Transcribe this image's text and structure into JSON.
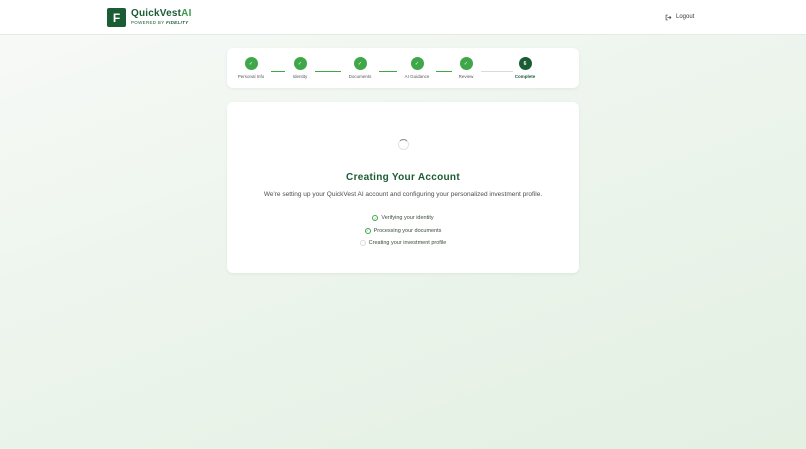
{
  "header": {
    "logo_letter": "F",
    "brand_name": "QuickVest",
    "brand_ai": "AI",
    "powered_by": "POWERED BY",
    "powered_by_brand": "FIDELITY",
    "logout_label": "Logout"
  },
  "steps": [
    {
      "label": "Personal Info",
      "status": "done",
      "marker": "✓"
    },
    {
      "label": "Identity",
      "status": "done",
      "marker": "✓"
    },
    {
      "label": "Documents",
      "status": "done",
      "marker": "✓"
    },
    {
      "label": "AI Guidance",
      "status": "done",
      "marker": "✓"
    },
    {
      "label": "Review",
      "status": "done",
      "marker": "✓"
    },
    {
      "label": "Complete",
      "status": "current",
      "marker": "6"
    }
  ],
  "main": {
    "title": "Creating Your Account",
    "subtitle": "We're setting up your QuickVest AI account and configuring your personalized investment profile.",
    "checklist": [
      {
        "label": "Verifying your identity",
        "status": "done"
      },
      {
        "label": "Processing your documents",
        "status": "done"
      },
      {
        "label": "Creating your investment profile",
        "status": "pending"
      }
    ]
  },
  "colors": {
    "brand_dark": "#1c5c34",
    "brand_green": "#3fa74a",
    "pending_gray": "#d6dcd6"
  }
}
